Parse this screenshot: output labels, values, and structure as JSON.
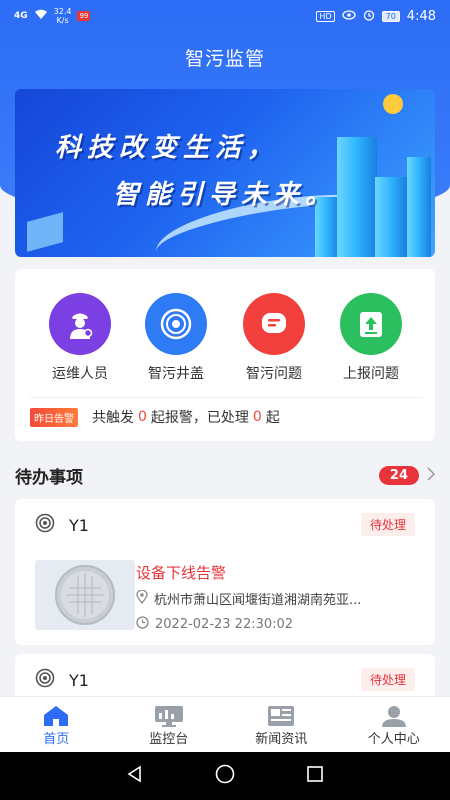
{
  "status_bar": {
    "signal": "4G",
    "speed_value": "32.4",
    "speed_unit": "K/s",
    "badge": "99",
    "hd": "HD",
    "battery": "70",
    "time": "4:48"
  },
  "app": {
    "title": "智污监管"
  },
  "banner": {
    "line1": "科技改变生活，",
    "line2": "智能引导未来。"
  },
  "quick_actions": [
    {
      "label": "运维人员",
      "icon": "maintenance-staff-icon",
      "color": "#7b3fe4"
    },
    {
      "label": "智污井盖",
      "icon": "manhole-cover-icon",
      "color": "#2f7af5"
    },
    {
      "label": "智污问题",
      "icon": "message-icon",
      "color": "#f2403c"
    },
    {
      "label": "上报问题",
      "icon": "upload-icon",
      "color": "#2bbf5f"
    }
  ],
  "alarm": {
    "tag": "昨日告警",
    "prefix": "共触发",
    "triggered": "0",
    "middle": "起报警，已处理",
    "handled": "0",
    "suffix": "起"
  },
  "todo": {
    "title": "待办事项",
    "count": "24",
    "items": [
      {
        "name": "Y1",
        "status": "待处理",
        "title": "设备下线告警",
        "address": "杭州市萧山区闻堰街道湘湖南苑亚...",
        "time": "2022-02-23 22:30:02"
      },
      {
        "name": "Y1",
        "status": "待处理"
      }
    ]
  },
  "tabbar": [
    {
      "label": "首页",
      "icon": "home-icon",
      "active": true
    },
    {
      "label": "监控台",
      "icon": "monitor-icon",
      "active": false
    },
    {
      "label": "新闻资讯",
      "icon": "news-icon",
      "active": false
    },
    {
      "label": "个人中心",
      "icon": "user-icon",
      "active": false
    }
  ],
  "colors": {
    "primary": "#2d6df6",
    "alert": "#e8343a"
  }
}
